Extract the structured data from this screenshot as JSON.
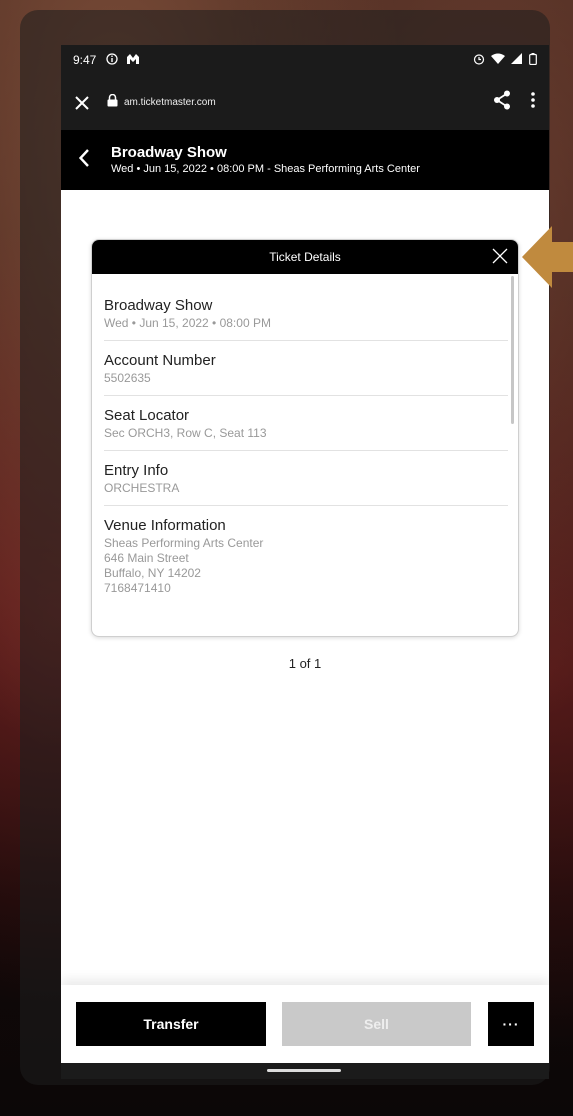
{
  "status_bar": {
    "time": "9:47"
  },
  "browser": {
    "url": "am.ticketmaster.com",
    "close_icon": "close-icon",
    "lock_icon": "lock-icon",
    "share_icon": "share-icon",
    "menu_icon": "more-vert-icon"
  },
  "header": {
    "title": "Broadway Show",
    "subtitle": "Wed • Jun 15, 2022 • 08:00 PM - Sheas Performing Arts Center"
  },
  "ticket_details": {
    "title": "Ticket Details",
    "rows": [
      {
        "label": "Broadway Show",
        "values": [
          "Wed • Jun 15, 2022 • 08:00 PM"
        ]
      },
      {
        "label": "Account Number",
        "values": [
          "5502635"
        ]
      },
      {
        "label": "Seat Locator",
        "values": [
          "Sec ORCH3, Row C, Seat 113"
        ]
      },
      {
        "label": "Entry Info",
        "values": [
          "ORCHESTRA"
        ]
      },
      {
        "label": "Venue Information",
        "values": [
          "Sheas Performing Arts Center",
          "646 Main Street",
          "Buffalo, NY 14202",
          "7168471410"
        ]
      }
    ]
  },
  "pager": "1 of 1",
  "actions": {
    "transfer": "Transfer",
    "sell": "Sell",
    "more": "···"
  },
  "colors": {
    "header_bg": "#000000",
    "accent_arrow": "#c08a3e",
    "sell_disabled": "#c9c9c9"
  }
}
